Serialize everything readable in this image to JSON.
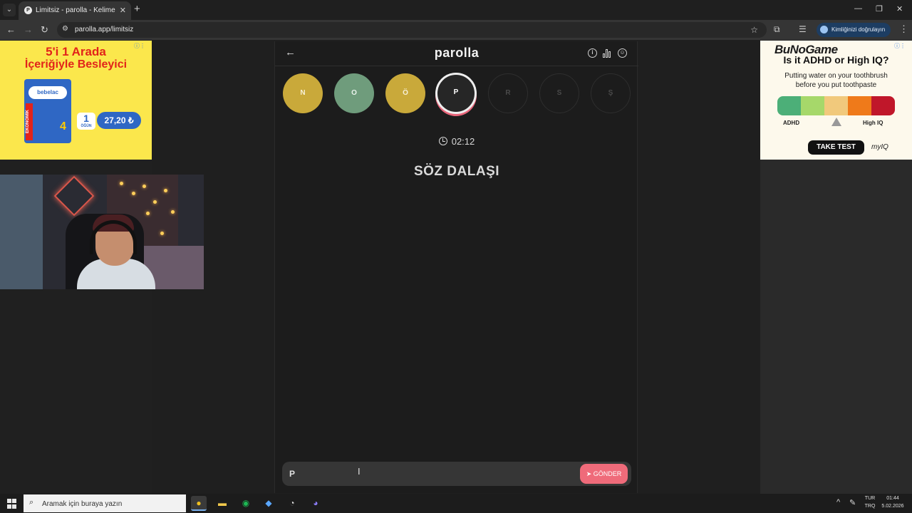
{
  "browser": {
    "tab_title": "Limitsiz - parolla - Kelime oyunu",
    "tab_list_icon": "chevron-down-icon",
    "url": "parolla.app/limitsiz",
    "verify_label": "Kimliğinizi doğrulayın"
  },
  "game": {
    "logo": "parolla",
    "timer": "02:12",
    "question": "SÖZ DALAŞI",
    "letters": [
      {
        "letter": "N",
        "state": "correct-yellow",
        "color": "#c9a93a"
      },
      {
        "letter": "O",
        "state": "correct-green",
        "color": "#6f9c7c"
      },
      {
        "letter": "Ö",
        "state": "correct-yellow",
        "color": "#c9a93a"
      },
      {
        "letter": "P",
        "state": "active",
        "color": "#262626"
      },
      {
        "letter": "R",
        "state": "empty",
        "color": "#1c1c1c"
      },
      {
        "letter": "S",
        "state": "empty",
        "color": "#1c1c1c"
      },
      {
        "letter": "Ş",
        "state": "empty",
        "color": "#1c1c1c"
      }
    ],
    "answer_value": "P",
    "send_label": "GÖNDER",
    "accent_color": "#ef6b7a"
  },
  "ad_left": {
    "headline1": "5'i 1 Arada",
    "headline2": "İçeriğiyle Besleyici",
    "brand": "bebelac",
    "side_label": "EKONOMİK",
    "stage": "4",
    "serving_num": "1",
    "serving_label": "ÖĞÜN",
    "price": "27,20 ₺"
  },
  "ad_right": {
    "brand": "BuNoGame",
    "title": "Is it ADHD or High IQ?",
    "subtitle_line1": "Putting water on your toothbrush",
    "subtitle_line2": "before you put toothpaste",
    "label_left": "ADHD",
    "label_right": "High IQ",
    "button": "TAKE TEST",
    "logo": "myIQ",
    "scale_colors": [
      "#4caf78",
      "#a6d86a",
      "#f1c97c",
      "#ef7a1a",
      "#c0172a"
    ]
  },
  "taskbar": {
    "search_placeholder": "Aramak için buraya yazın",
    "lang1": "TUR",
    "lang2": "TRQ",
    "time": "01:44",
    "date": "5.02.2026"
  }
}
